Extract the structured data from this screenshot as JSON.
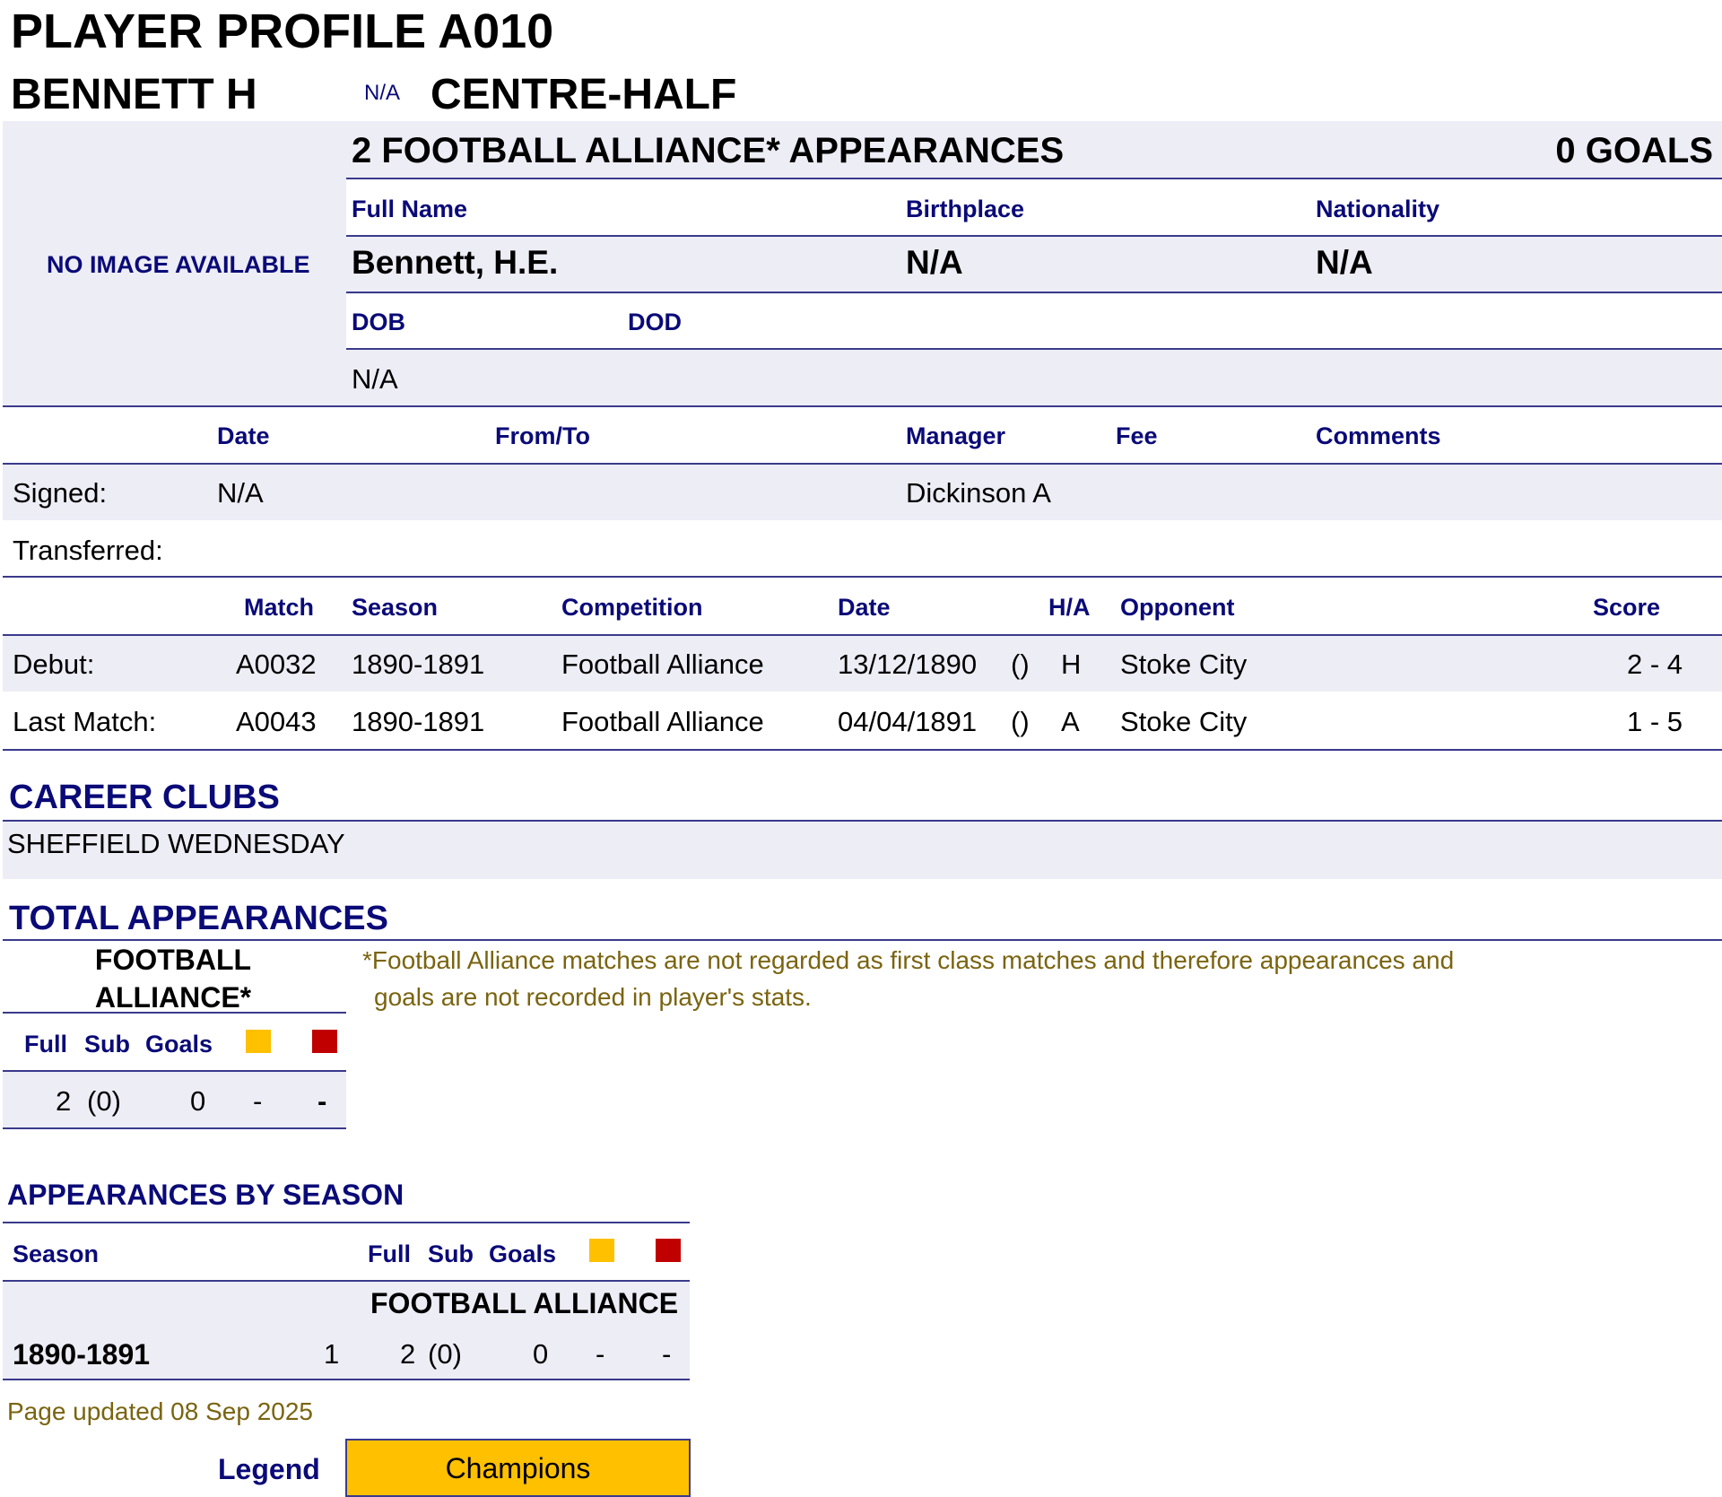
{
  "title": "PLAYER PROFILE A010",
  "short_name": "BENNETT H",
  "number": "N/A",
  "position": "CENTRE-HALF",
  "appearances_header": "2 FOOTBALL ALLIANCE* APPEARANCES",
  "goals_header": "0 GOALS",
  "no_image": "NO IMAGE AVAILABLE",
  "bio": {
    "full_name_label": "Full Name",
    "birthplace_label": "Birthplace",
    "nationality_label": "Nationality",
    "full_name": "Bennett, H.E.",
    "birthplace": "N/A",
    "nationality": "N/A",
    "dob_label": "DOB",
    "dod_label": "DOD",
    "dob": "N/A",
    "dod": ""
  },
  "transfers": {
    "headers": {
      "date": "Date",
      "from_to": "From/To",
      "manager": "Manager",
      "fee": "Fee",
      "comments": "Comments"
    },
    "signed": {
      "label": "Signed:",
      "date": "N/A",
      "manager": "Dickinson A"
    },
    "transferred": {
      "label": "Transferred:"
    }
  },
  "matches": {
    "headers": {
      "match": "Match",
      "season": "Season",
      "competition": "Competition",
      "date": "Date",
      "ha": "H/A",
      "opponent": "Opponent",
      "score": "Score"
    },
    "rows": [
      {
        "label": "Debut:",
        "match": "A0032",
        "season": "1890-1891",
        "competition": "Football Alliance",
        "date": "13/12/1890",
        "paren": "()",
        "ha": "H",
        "opponent": "Stoke City",
        "score": "2 - 4"
      },
      {
        "label": "Last Match:",
        "match": "A0043",
        "season": "1890-1891",
        "competition": "Football Alliance",
        "date": "04/04/1891",
        "paren": "()",
        "ha": "A",
        "opponent": "Stoke City",
        "score": "1 - 5"
      }
    ]
  },
  "career": {
    "title": "CAREER CLUBS",
    "clubs": "SHEFFIELD WEDNESDAY"
  },
  "totals": {
    "title": "TOTAL APPEARANCES",
    "comp_line1": "FOOTBALL",
    "comp_line2": "ALLIANCE*",
    "full_label": "Full",
    "sub_label": "Sub",
    "goals_label": "Goals",
    "full": "2",
    "sub": "(0)",
    "goals": "0",
    "yellow": "-",
    "red": "-",
    "note_line1": "*Football Alliance matches are not regarded as first class matches and therefore appearances and",
    "note_line2": "goals are not recorded in player's stats."
  },
  "by_season": {
    "title": "APPEARANCES BY SEASON",
    "season_label": "Season",
    "full_label": "Full",
    "sub_label": "Sub",
    "goals_label": "Goals",
    "competition": "FOOTBALL ALLIANCE",
    "rows": [
      {
        "season": "1890-1891",
        "count": "1",
        "full": "2",
        "sub": "(0)",
        "goals": "0",
        "yellow": "-",
        "red": "-"
      }
    ]
  },
  "updated": "Page updated 08 Sep 2025",
  "legend": {
    "label": "Legend",
    "champions": "Champions"
  },
  "colors": {
    "navy": "#0a0a78",
    "yellow": "#ffc000",
    "red": "#c00000",
    "grey": "#ededf6"
  }
}
